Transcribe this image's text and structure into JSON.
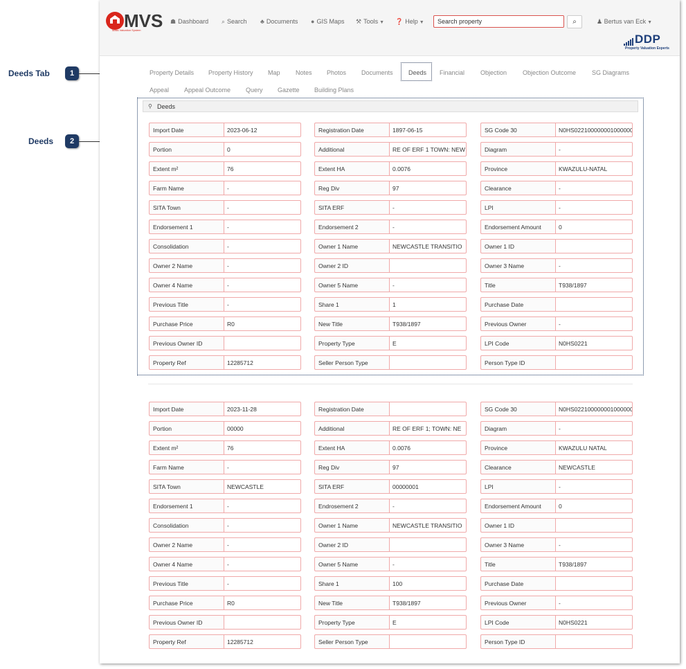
{
  "header": {
    "logo_text": "MVS",
    "logo_subtitle": "Mass Valuation System",
    "nav": [
      {
        "label": "Dashboard",
        "icon": "dashboard-icon",
        "glyph": "☗"
      },
      {
        "label": "Search",
        "icon": "search-icon",
        "glyph": "⌕"
      },
      {
        "label": "Documents",
        "icon": "user-docs-icon",
        "glyph": "♣"
      },
      {
        "label": "GIS Maps",
        "icon": "globe-icon",
        "glyph": "●"
      },
      {
        "label": "Tools",
        "icon": "wrench-icon",
        "glyph": "⚒"
      },
      {
        "label": "Help",
        "icon": "help-icon",
        "glyph": "❓"
      }
    ],
    "search_placeholder": "Search property",
    "user_name": "Bertus van Eck",
    "brand_text": "DDP",
    "brand_sub": "Property Valuation Experts",
    "brand_color": "#1e3f7a",
    "accent_color": "#d9534f"
  },
  "tabs": {
    "row1": [
      "Property Details",
      "Property History",
      "Map",
      "Notes",
      "Photos",
      "Documents",
      "Deeds",
      "Financial",
      "Objection",
      "Objection Outcome",
      "SG Diagrams"
    ],
    "row2": [
      "Appeal",
      "Appeal Outcome",
      "Query",
      "Gazette",
      "Building Plans"
    ],
    "active": "Deeds"
  },
  "section": {
    "title": "Deeds"
  },
  "callouts": [
    {
      "number": "1",
      "label": "Deeds Tab"
    },
    {
      "number": "2",
      "label": "Deeds"
    }
  ],
  "records": [
    {
      "rows": [
        [
          [
            "Import Date",
            "2023-06-12"
          ],
          [
            "Registration Date",
            "1897-06-15"
          ],
          [
            "SG Code 30",
            "N0HS022100000001000000"
          ]
        ],
        [
          [
            "Portion",
            "0"
          ],
          [
            "Additional",
            "RE OF ERF 1 TOWN: NEW"
          ],
          [
            "Diagram",
            "-"
          ]
        ],
        [
          [
            "Extent m²",
            "76"
          ],
          [
            "Extent HA",
            "0.0076"
          ],
          [
            "Province",
            "KWAZULU-NATAL"
          ]
        ],
        [
          [
            "Farm Name",
            "-"
          ],
          [
            "Reg Div",
            "97"
          ],
          [
            "Clearance",
            "-"
          ]
        ],
        [
          [
            "SITA Town",
            "-"
          ],
          [
            "SITA ERF",
            "-"
          ],
          [
            "LPI",
            "-"
          ]
        ],
        [
          [
            "Endorsement 1",
            "-"
          ],
          [
            "Endorsement 2",
            "-"
          ],
          [
            "Endorsement Amount",
            "0"
          ]
        ],
        [
          [
            "Consolidation",
            "-"
          ],
          [
            "Owner 1 Name",
            "NEWCASTLE TRANSITIO"
          ],
          [
            "Owner 1 ID",
            ""
          ]
        ],
        [
          [
            "Owner 2 Name",
            "-"
          ],
          [
            "Owner 2 ID",
            ""
          ],
          [
            "Owner 3 Name",
            "-"
          ]
        ],
        [
          [
            "Owner 4 Name",
            "-"
          ],
          [
            "Owner 5 Name",
            "-"
          ],
          [
            "Title",
            "T938/1897"
          ]
        ],
        [
          [
            "Previous Title",
            "-"
          ],
          [
            "Share 1",
            "1"
          ],
          [
            "Purchase Date",
            ""
          ]
        ],
        [
          [
            "Purchase Price",
            "R0"
          ],
          [
            "New Title",
            "T938/1897"
          ],
          [
            "Previous Owner",
            "-"
          ]
        ],
        [
          [
            "Previous Owner ID",
            ""
          ],
          [
            "Property Type",
            "E"
          ],
          [
            "LPI Code",
            "N0HS0221"
          ]
        ],
        [
          [
            "Property Ref",
            "12285712"
          ],
          [
            "Seller Person Type",
            ""
          ],
          [
            "Person Type ID",
            ""
          ]
        ]
      ]
    },
    {
      "rows": [
        [
          [
            "Import Date",
            "2023-11-28"
          ],
          [
            "Registration Date",
            ""
          ],
          [
            "SG Code 30",
            "N0HS022100000001000000"
          ]
        ],
        [
          [
            "Portion",
            "00000"
          ],
          [
            "Additional",
            "RE OF ERF 1; TOWN: NE"
          ],
          [
            "Diagram",
            "-"
          ]
        ],
        [
          [
            "Extent m²",
            "76"
          ],
          [
            "Extent HA",
            "0.0076"
          ],
          [
            "Province",
            "KWAZULU NATAL"
          ]
        ],
        [
          [
            "Farm Name",
            "-"
          ],
          [
            "Reg Div",
            "97"
          ],
          [
            "Clearance",
            "NEWCASTLE"
          ]
        ],
        [
          [
            "SITA Town",
            "NEWCASTLE"
          ],
          [
            "SITA ERF",
            "00000001"
          ],
          [
            "LPI",
            "-"
          ]
        ],
        [
          [
            "Endorsement 1",
            "-"
          ],
          [
            "Endrosement 2",
            "-"
          ],
          [
            "Endorsement Amount",
            "0"
          ]
        ],
        [
          [
            "Consolidation",
            "-"
          ],
          [
            "Owner 1 Name",
            "NEWCASTLE TRANSITIO"
          ],
          [
            "Owner 1 ID",
            ""
          ]
        ],
        [
          [
            "Owner 2 Name",
            "-"
          ],
          [
            "Owner 2 ID",
            ""
          ],
          [
            "Owner 3 Name",
            "-"
          ]
        ],
        [
          [
            "Owner 4 Name",
            "-"
          ],
          [
            "Owner 5 Name",
            "-"
          ],
          [
            "Title",
            "T938/1897"
          ]
        ],
        [
          [
            "Previous Title",
            "-"
          ],
          [
            "Share 1",
            "100"
          ],
          [
            "Purchase Date",
            ""
          ]
        ],
        [
          [
            "Purchase Price",
            "R0"
          ],
          [
            "New Title",
            "T938/1897"
          ],
          [
            "Previous Owner",
            "-"
          ]
        ],
        [
          [
            "Previous Owner ID",
            ""
          ],
          [
            "Property Type",
            "E"
          ],
          [
            "LPI Code",
            "N0HS0221"
          ]
        ],
        [
          [
            "Property Ref",
            "12285712"
          ],
          [
            "Seller Person Type",
            ""
          ],
          [
            "Person Type ID",
            ""
          ]
        ]
      ]
    }
  ]
}
